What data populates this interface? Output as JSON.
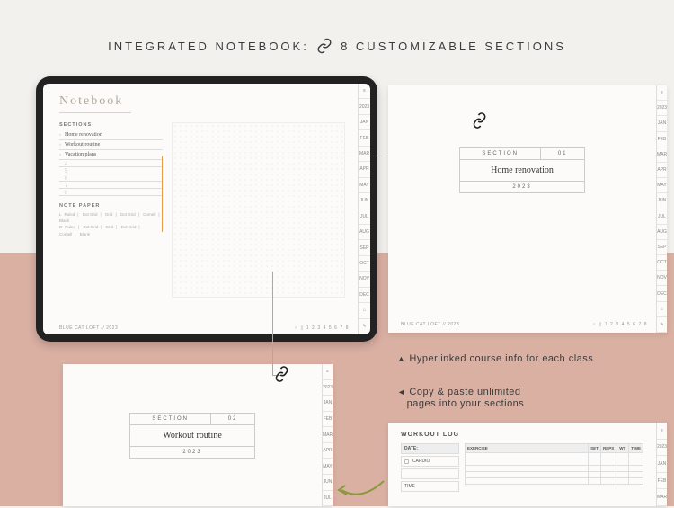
{
  "title": {
    "a": "INTEGRATED NOTEBOOK:",
    "b": "8 CUSTOMIZABLE SECTIONS"
  },
  "notebook": {
    "heading": "Notebook",
    "sections_label": "SECTIONS",
    "sections": [
      "Home renovation",
      "Workout routine",
      "Vacation plans"
    ],
    "empty_slots": [
      "4",
      "5",
      "6",
      "7",
      "8"
    ],
    "notepaper_label": "NOTE PAPER",
    "notepaper_row1": [
      "Ruled",
      "Dot Grid",
      "Grid",
      "Dot Grid",
      "Cornell",
      "Blank"
    ],
    "notepaper_row2": [
      "Ruled",
      "Dot Grid",
      "Grid",
      "Dot Grid",
      "Cornell",
      "Blank"
    ],
    "footer_left": "BLUE CAT LOFT // 2023",
    "pager": [
      "1",
      "2",
      "3",
      "4",
      "5",
      "6",
      "7",
      "8"
    ],
    "tabs": [
      "≡",
      "2023",
      "JAN",
      "FEB",
      "MAR",
      "APR",
      "MAY",
      "JUN",
      "JUL",
      "AUG",
      "SEP",
      "OCT",
      "NOV",
      "DEC",
      "⌂",
      "✎"
    ]
  },
  "sectionA": {
    "label": "SECTION",
    "num": "01",
    "name": "Home renovation",
    "year": "2023",
    "footer": "BLUE CAT LOFT // 2023",
    "pager": [
      "1",
      "2",
      "3",
      "4",
      "5",
      "6",
      "7",
      "8"
    ]
  },
  "sectionB": {
    "label": "SECTION",
    "num": "02",
    "name": "Workout routine",
    "year": "2023"
  },
  "workout": {
    "title": "WORKOUT LOG",
    "date": "DATE:",
    "cardio": "CARDIO",
    "time": "TIME",
    "ex": "EXERCISE",
    "cols": [
      "SET",
      "REPS",
      "WT",
      "TIME"
    ]
  },
  "captions": {
    "a": "Hyperlinked course info for each class",
    "b1": "Copy & paste unlimited",
    "b2": "pages into your sections"
  }
}
